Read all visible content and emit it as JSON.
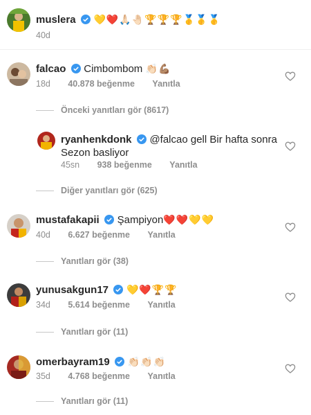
{
  "caption": {
    "username": "muslera",
    "text": "💛❤️🙏🏻🤚🏻🏆🏆🏆🥇🥇🥇",
    "time": "40d"
  },
  "comments": [
    {
      "username": "falcao",
      "text": "Cimbombom",
      "emoji": "👏🏻💪🏽",
      "time": "18d",
      "likes": "40.878 beğenme",
      "reply_label": "Yanıtla",
      "thread_label": "Önceki yanıtları gör (8617)"
    },
    {
      "username": "ryanhenkdonk",
      "text_line1": "@falcao gell  Bir hafta sonra",
      "text_line2": "Sezon basliyor",
      "time": "45sn",
      "likes": "938 beğenme",
      "reply_label": "Yanıtla",
      "thread_label": "Diğer yanıtları gör (625)"
    },
    {
      "username": "mustafakapii",
      "text": "Şampiyon",
      "emoji": "❤️❤️💛💛",
      "time": "40d",
      "likes": "6.627 beğenme",
      "reply_label": "Yanıtla",
      "thread_label": "Yanıtları gör (38)"
    },
    {
      "username": "yunusakgun17",
      "emoji": "💛❤️🏆🏆",
      "time": "34d",
      "likes": "5.614 beğenme",
      "reply_label": "Yanıtla",
      "thread_label": "Yanıtları gör (11)"
    },
    {
      "username": "omerbayram19",
      "emoji": "👏🏻👏🏻👏🏻",
      "time": "35d",
      "likes": "4.768 beğenme",
      "reply_label": "Yanıtla",
      "thread_label": "Yanıtları gör (11)"
    }
  ],
  "colors": {
    "verified": "#3897f0",
    "meta_text": "#8e8e8e",
    "text": "#262626"
  },
  "icons": {
    "like": "heart-outline-icon",
    "verified": "verified-badge-icon"
  }
}
